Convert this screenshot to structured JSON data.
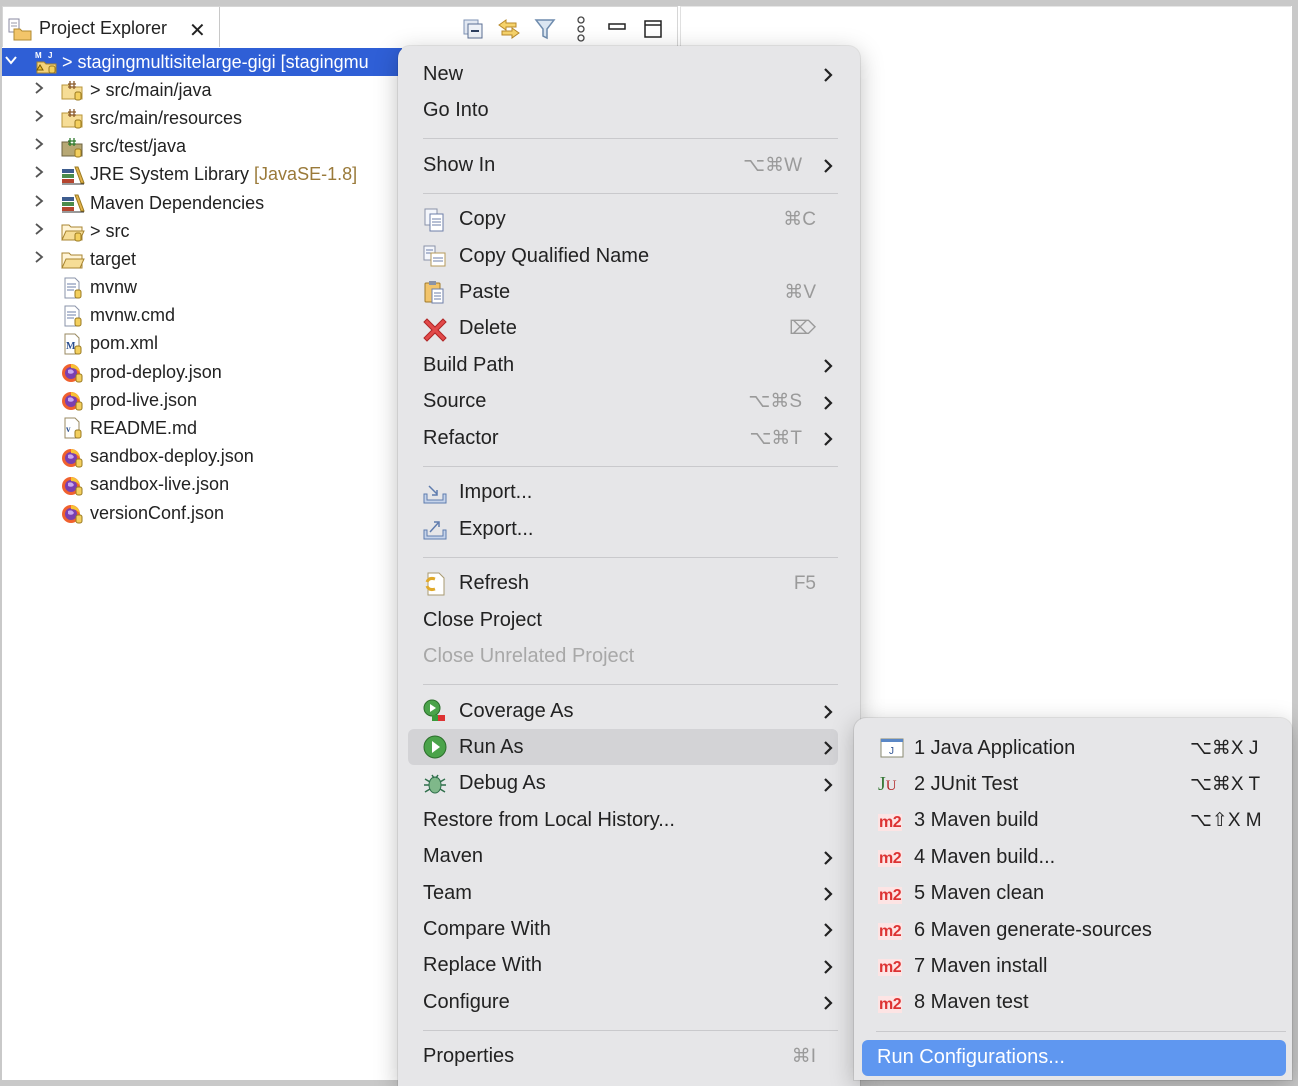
{
  "explorer": {
    "tab_title": "Project Explorer",
    "close_icon": "close-icon",
    "toolbar": [
      {
        "name": "collapse-all-icon"
      },
      {
        "name": "link-with-editor-icon"
      },
      {
        "name": "filter-icon"
      },
      {
        "name": "view-menu-icon"
      },
      {
        "name": "minimize-icon"
      },
      {
        "name": "maximize-icon"
      }
    ],
    "tree": [
      {
        "label": "> stagingmultisitelarge-gigi [stagingmu",
        "decoration": "",
        "expanded": true,
        "expandable": true,
        "icon": "maven-project-icon",
        "selected": true,
        "depth": 0
      },
      {
        "label": "> src/main/java",
        "decoration": "",
        "expandable": true,
        "icon": "source-folder-icon",
        "depth": 1
      },
      {
        "label": "src/main/resources",
        "decoration": "",
        "expandable": true,
        "icon": "source-folder-icon",
        "depth": 1
      },
      {
        "label": "src/test/java",
        "decoration": "",
        "expandable": true,
        "icon": "test-source-folder-icon",
        "depth": 1
      },
      {
        "label": "JRE System Library ",
        "decoration": "[JavaSE-1.8]",
        "expandable": true,
        "icon": "library-icon",
        "depth": 1
      },
      {
        "label": "Maven Dependencies",
        "decoration": "",
        "expandable": true,
        "icon": "library-icon",
        "depth": 1
      },
      {
        "label": "> src",
        "decoration": "",
        "expandable": true,
        "icon": "folder-icon",
        "depth": 1
      },
      {
        "label": "target",
        "decoration": "",
        "expandable": true,
        "icon": "folder-open-icon",
        "depth": 1
      },
      {
        "label": "mvnw",
        "decoration": "",
        "expandable": false,
        "icon": "text-file-icon",
        "depth": 1
      },
      {
        "label": "mvnw.cmd",
        "decoration": "",
        "expandable": false,
        "icon": "text-file-icon",
        "depth": 1
      },
      {
        "label": "pom.xml",
        "decoration": "",
        "expandable": false,
        "icon": "maven-pom-icon",
        "depth": 1
      },
      {
        "label": "prod-deploy.json",
        "decoration": "",
        "expandable": false,
        "icon": "firefox-icon",
        "depth": 1
      },
      {
        "label": "prod-live.json",
        "decoration": "",
        "expandable": false,
        "icon": "firefox-icon",
        "depth": 1
      },
      {
        "label": "README.md",
        "decoration": "",
        "expandable": false,
        "icon": "markdown-file-icon",
        "depth": 1
      },
      {
        "label": "sandbox-deploy.json",
        "decoration": "",
        "expandable": false,
        "icon": "firefox-icon",
        "depth": 1
      },
      {
        "label": "sandbox-live.json",
        "decoration": "",
        "expandable": false,
        "icon": "firefox-icon",
        "depth": 1
      },
      {
        "label": "versionConf.json",
        "decoration": "",
        "expandable": false,
        "icon": "firefox-icon",
        "depth": 1
      }
    ]
  },
  "context_menu": {
    "items": [
      {
        "label": "New",
        "submenu": true
      },
      {
        "label": "Go Into"
      },
      {
        "separator": true
      },
      {
        "label": "Show In",
        "shortcut": "⌥⌘W",
        "submenu": true
      },
      {
        "separator": true
      },
      {
        "label": "Copy",
        "shortcut": "⌘C",
        "icon": "copy-icon"
      },
      {
        "label": "Copy Qualified Name",
        "icon": "copy-qualified-name-icon"
      },
      {
        "label": "Paste",
        "shortcut": "⌘V",
        "icon": "paste-icon"
      },
      {
        "label": "Delete",
        "shortcut": "⌦",
        "icon": "delete-icon"
      },
      {
        "label": "Build Path",
        "submenu": true
      },
      {
        "label": "Source",
        "shortcut": "⌥⌘S",
        "submenu": true
      },
      {
        "label": "Refactor",
        "shortcut": "⌥⌘T",
        "submenu": true
      },
      {
        "separator": true
      },
      {
        "label": "Import...",
        "icon": "import-icon"
      },
      {
        "label": "Export...",
        "icon": "export-icon"
      },
      {
        "separator": true
      },
      {
        "label": "Refresh",
        "shortcut": "F5",
        "icon": "refresh-icon"
      },
      {
        "label": "Close Project"
      },
      {
        "label": "Close Unrelated Project",
        "disabled": true
      },
      {
        "separator": true
      },
      {
        "label": "Coverage As",
        "submenu": true,
        "icon": "coverage-icon"
      },
      {
        "label": "Run As",
        "submenu": true,
        "icon": "run-icon",
        "highlighted": true
      },
      {
        "label": "Debug As",
        "submenu": true,
        "icon": "debug-icon"
      },
      {
        "label": "Restore from Local History..."
      },
      {
        "label": "Maven",
        "submenu": true
      },
      {
        "label": "Team",
        "submenu": true
      },
      {
        "label": "Compare With",
        "submenu": true
      },
      {
        "label": "Replace With",
        "submenu": true
      },
      {
        "label": "Configure",
        "submenu": true
      },
      {
        "separator": true
      },
      {
        "label": "Properties",
        "shortcut": "⌘I"
      }
    ]
  },
  "run_as_submenu": {
    "items": [
      {
        "label": "1 Java Application",
        "shortcut": "⌥⌘X J",
        "icon": "java-application-icon"
      },
      {
        "label": "2 JUnit Test",
        "shortcut": "⌥⌘X T",
        "icon": "junit-icon"
      },
      {
        "label": "3 Maven build",
        "shortcut": "⌥⇧X M",
        "icon": "maven-m2-icon"
      },
      {
        "label": "4 Maven build...",
        "icon": "maven-m2-icon"
      },
      {
        "label": "5 Maven clean",
        "icon": "maven-m2-icon"
      },
      {
        "label": "6 Maven generate-sources",
        "icon": "maven-m2-icon"
      },
      {
        "label": "7 Maven install",
        "icon": "maven-m2-icon"
      },
      {
        "label": "8 Maven test",
        "icon": "maven-m2-icon"
      },
      {
        "separator": true
      },
      {
        "label": "Run Configurations...",
        "active": true
      }
    ]
  },
  "colors": {
    "selection": "#2f5fd6",
    "menu_bg": "#e6e6e8",
    "menu_hover": "#d3d3d6",
    "submenu_active": "#5f97f0",
    "shortcut_gray": "#9a9a9a",
    "decoration": "#9a7a3a"
  }
}
